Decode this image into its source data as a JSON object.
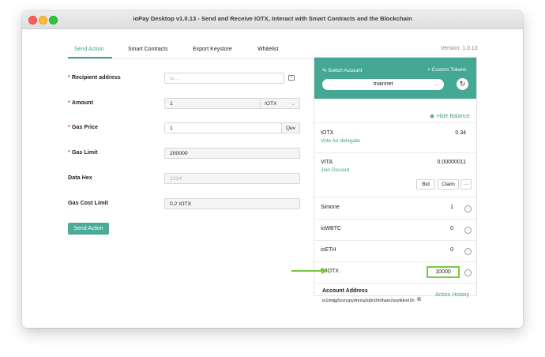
{
  "window": {
    "title": "ioPay Desktop v1.0.13 - Send and Receive IOTX, Interact with Smart Contracts and the Blockchain"
  },
  "version": "Version: 1.0.13",
  "tabs": [
    "Send Action",
    "Smart Contracts",
    "Export Keystore",
    "Whitelist"
  ],
  "form": {
    "recipient_label": "Recipient address",
    "recipient_placeholder": "io...",
    "amount_label": "Amount",
    "amount_value": "1",
    "amount_unit": "IOTX",
    "gas_price_label": "Gas Price",
    "gas_price_value": "1",
    "gas_price_unit": "Qev",
    "gas_limit_label": "Gas Limit",
    "gas_limit_value": "200000",
    "data_hex_label": "Data Hex",
    "data_hex_placeholder": "1234",
    "gas_cost_label": "Gas Cost Limit",
    "gas_cost_value": "0.2 IOTX",
    "send_button": "Send Action"
  },
  "wallet": {
    "switch_account": "Switch Account",
    "custom_tokens": "+ Custom Tokens",
    "network": "mainnet",
    "hide_balance": "Hide Balance",
    "iotx": {
      "name": "IOTX",
      "balance": "0.34",
      "link": "Vote for delegate"
    },
    "vita": {
      "name": "VITA",
      "balance": "0.00000011",
      "link": "Join Discord",
      "bid": "Bid",
      "claim": "Claim",
      "more": "···"
    },
    "tokens": [
      {
        "name": "Simone",
        "balance": "1"
      },
      {
        "name": "ioWBTC",
        "balance": "0"
      },
      {
        "name": "ioETH",
        "balance": "0"
      },
      {
        "name": "WIOTX",
        "balance": "10000"
      }
    ],
    "account_address_label": "Account Address",
    "account_address": "io1dvtjg5xxnzpydnmq2q0n0h0ham2arytkkvrl2h",
    "action_history": "Action History"
  },
  "colors": {
    "accent": "#44a895",
    "highlight": "#79c943",
    "required": "#e0464e"
  }
}
